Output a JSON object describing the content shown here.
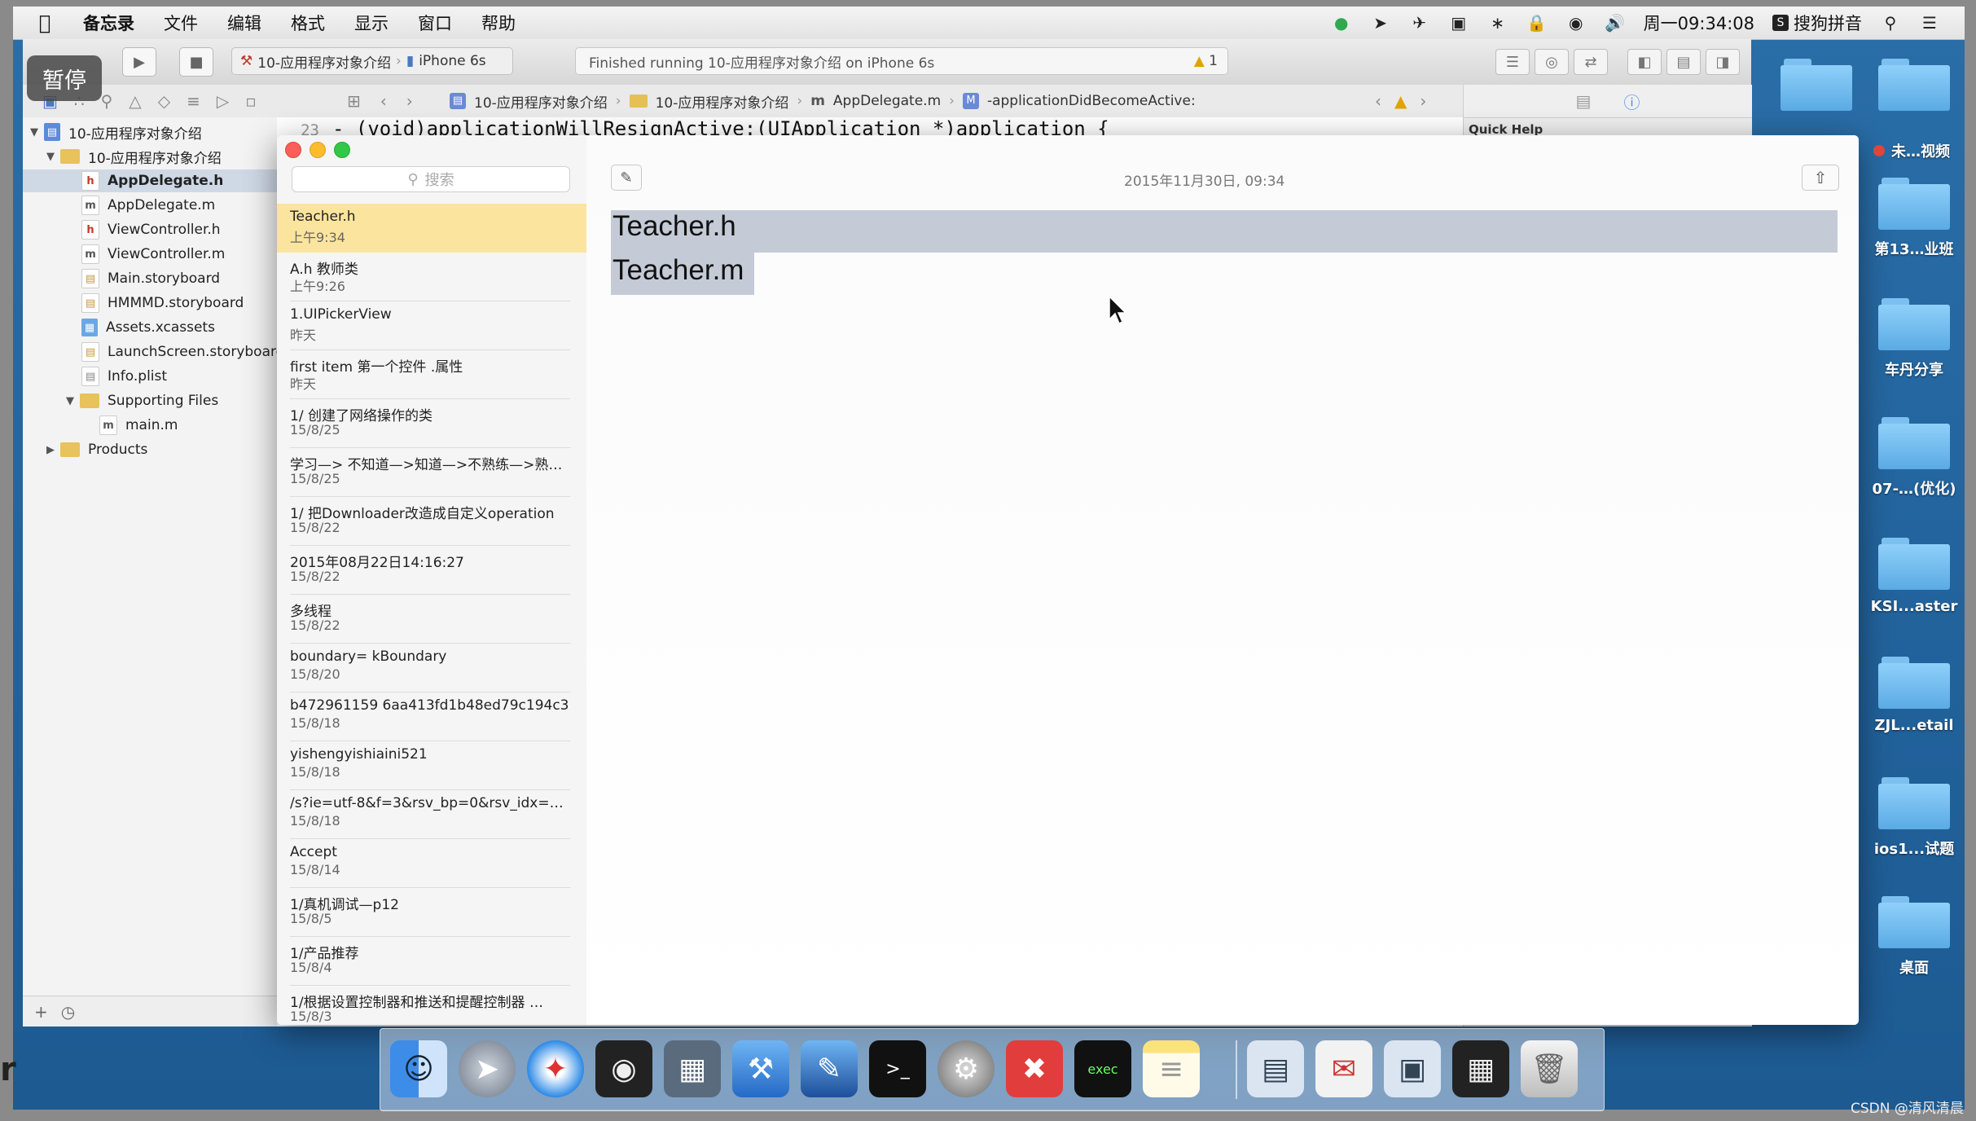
{
  "menubar": {
    "apple": "",
    "app": "备忘录",
    "items": [
      "文件",
      "编辑",
      "格式",
      "显示",
      "窗口",
      "帮助"
    ],
    "clock": "周一09:34:08",
    "input_method": "搜狗拼音",
    "volume_icon": "speaker-icon"
  },
  "overlay": {
    "pause_label": "暂停"
  },
  "xcode": {
    "scheme_project": "10-应用程序对象介绍",
    "scheme_device": "iPhone 6s",
    "activity_text": "Finished running 10-应用程序对象介绍 on iPhone 6s",
    "warning_count": "1",
    "jump_bar": [
      "10-应用程序对象介绍",
      "10-应用程序对象介绍",
      "AppDelegate.m",
      "-applicationDidBecomeActive:"
    ],
    "code_line_number": "23",
    "code_line": "- (void)applicationWillResignActive:(UIApplication *)application {",
    "quick_help": "Quick Help",
    "tree": [
      {
        "label": "10-应用程序对象介绍",
        "type": "proj"
      },
      {
        "label": "10-应用程序对象介绍",
        "type": "folder"
      },
      {
        "label": "AppDelegate.h",
        "type": "h"
      },
      {
        "label": "AppDelegate.m",
        "type": "m"
      },
      {
        "label": "ViewController.h",
        "type": "h"
      },
      {
        "label": "ViewController.m",
        "type": "m"
      },
      {
        "label": "Main.storyboard",
        "type": "sb"
      },
      {
        "label": "HMMMD.storyboard",
        "type": "sb"
      },
      {
        "label": "Assets.xcassets",
        "type": "as"
      },
      {
        "label": "LaunchScreen.storyboard",
        "type": "sb"
      },
      {
        "label": "Info.plist",
        "type": "pl"
      },
      {
        "label": "Supporting Files",
        "type": "folder"
      },
      {
        "label": "main.m",
        "type": "m"
      },
      {
        "label": "Products",
        "type": "folder"
      }
    ]
  },
  "notes": {
    "search_placeholder": "搜索",
    "date": "2015年11月30日, 09:34",
    "content_lines": [
      "Teacher.h",
      "Teacher.m"
    ],
    "items": [
      {
        "title": "Teacher.h",
        "date": "上午9:34"
      },
      {
        "title": "A.h  教师类",
        "date": "上午9:26"
      },
      {
        "title": "1.UIPickerView",
        "date": "昨天"
      },
      {
        "title": "first item 第一个控件 .属性",
        "date": "昨天"
      },
      {
        "title": "1/ 创建了网络操作的类",
        "date": "15/8/25"
      },
      {
        "title": "学习—> 不知道—>知道—>不熟练—>熟…",
        "date": "15/8/25"
      },
      {
        "title": "1/ 把Downloader改造成自定义operation",
        "date": "15/8/22"
      },
      {
        "title": "2015年08月22日14:16:27",
        "date": "15/8/22"
      },
      {
        "title": "多线程",
        "date": "15/8/22"
      },
      {
        "title": "boundary= kBoundary",
        "date": "15/8/20"
      },
      {
        "title": "b472961159 6aa413fd1b48ed79c194c3",
        "date": "15/8/18"
      },
      {
        "title": "yishengyishiaini521",
        "date": "15/8/18"
      },
      {
        "title": "/s?ie=utf-8&f=3&rsv_bp=0&rsv_idx=1…",
        "date": "15/8/18"
      },
      {
        "title": "Accept",
        "date": "15/8/14"
      },
      {
        "title": "1/真机调试—p12",
        "date": "15/8/5"
      },
      {
        "title": "1/产品推荐",
        "date": "15/8/4"
      },
      {
        "title": "1/根据设置控制器和推送和提醒控制器 …",
        "date": "15/8/3"
      }
    ]
  },
  "desktop": {
    "tag_label": "未…视频",
    "icons": [
      "",
      "",
      "第13…业班",
      "车丹分享",
      "07-…(优化)",
      "KSI...aster",
      "ZJL...etail",
      "ios1...试题",
      "桌面"
    ]
  },
  "dock": {
    "apps": [
      "finder",
      "launchpad",
      "safari",
      "mouse",
      "photo-booth",
      "xcode",
      "instruments",
      "terminal",
      "system-preferences",
      "xmind",
      "exec",
      "notes",
      "screen-share",
      "mail-app",
      "remote-desktop",
      "calculator",
      "trash"
    ]
  },
  "watermark": "CSDN @清风清晨",
  "left_edge_mark": "r"
}
